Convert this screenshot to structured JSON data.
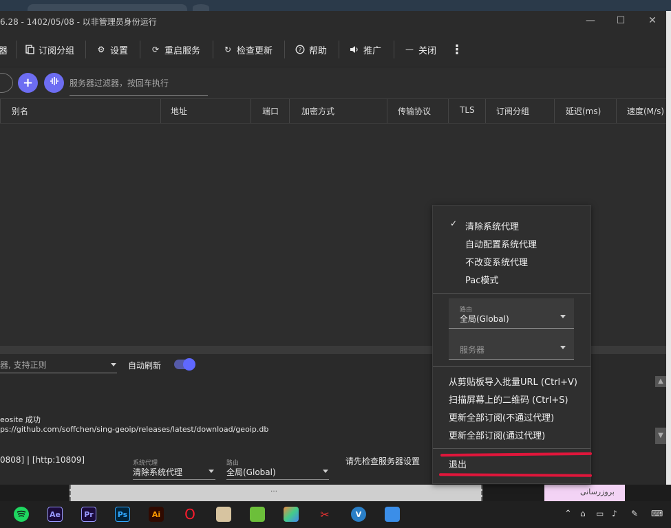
{
  "window": {
    "title": "6.28 - 1402/05/08 - 以非管理员身份运行"
  },
  "toolbar": {
    "items": [
      {
        "label": "器",
        "icon": "server-icon"
      },
      {
        "label": "订阅分组",
        "icon": "subscription-icon"
      },
      {
        "label": "设置",
        "icon": "gear-icon"
      },
      {
        "label": "重启服务",
        "icon": "restart-icon"
      },
      {
        "label": "检查更新",
        "icon": "update-icon"
      },
      {
        "label": "帮助",
        "icon": "help-icon"
      },
      {
        "label": "推广",
        "icon": "speaker-icon"
      },
      {
        "label": "关闭",
        "icon": "minus-icon"
      }
    ]
  },
  "filter": {
    "placeholder": "服务器过滤器，按回车执行"
  },
  "table": {
    "columns": [
      "别名",
      "地址",
      "端口",
      "加密方式",
      "传输协议",
      "TLS",
      "订阅分组",
      "延迟(ms)",
      "速度(M/s)"
    ]
  },
  "bottom": {
    "log_filter_placeholder": "器, 支持正则",
    "auto_refresh_label": "自动刷新",
    "log_lines": [
      "eosite 成功",
      "ps://github.com/soffchen/sing-geoip/releases/latest/download/geoip.db"
    ],
    "status_ports": "0808] | [http:10809]",
    "system_proxy_label": "系统代理",
    "system_proxy_value": "清除系统代理",
    "routing_label": "路由",
    "routing_value": "全局(Global)",
    "server_hint": "请先检查服务器设置"
  },
  "context_menu": {
    "proxy_modes": [
      {
        "label": "清除系统代理",
        "checked": true
      },
      {
        "label": "自动配置系统代理",
        "checked": false
      },
      {
        "label": "不改变系统代理",
        "checked": false
      },
      {
        "label": "Pac模式",
        "checked": false
      }
    ],
    "routing_label": "路由",
    "routing_value": "全局(Global)",
    "server_placeholder": "服务器",
    "actions": [
      "从剪贴板导入批量URL (Ctrl+V)",
      "扫描屏幕上的二维码 (Ctrl+S)",
      "更新全部订阅(不通过代理)",
      "更新全部订阅(通过代理)"
    ],
    "exit_label": "退出",
    "check_glyph": "✓"
  },
  "underlay": {
    "pink_text": "بروزرسانی",
    "gray_text": "…"
  },
  "taskbar": {
    "apps": [
      {
        "label": "",
        "icon": "spotify-icon",
        "color": "#1ed760"
      },
      {
        "label": "Ae",
        "icon": "after-effects-icon",
        "color": "#9999ff"
      },
      {
        "label": "Pr",
        "icon": "premiere-icon",
        "color": "#9999ff"
      },
      {
        "label": "Ps",
        "icon": "photoshop-icon",
        "color": "#31a8ff"
      },
      {
        "label": "Ai",
        "icon": "illustrator-icon",
        "color": "#ff9a00"
      },
      {
        "label": "O",
        "icon": "opera-icon",
        "color": "#ff1b2d"
      }
    ],
    "colors": {
      "accent": "#6d6df2",
      "highlight": "#e0163b"
    }
  }
}
